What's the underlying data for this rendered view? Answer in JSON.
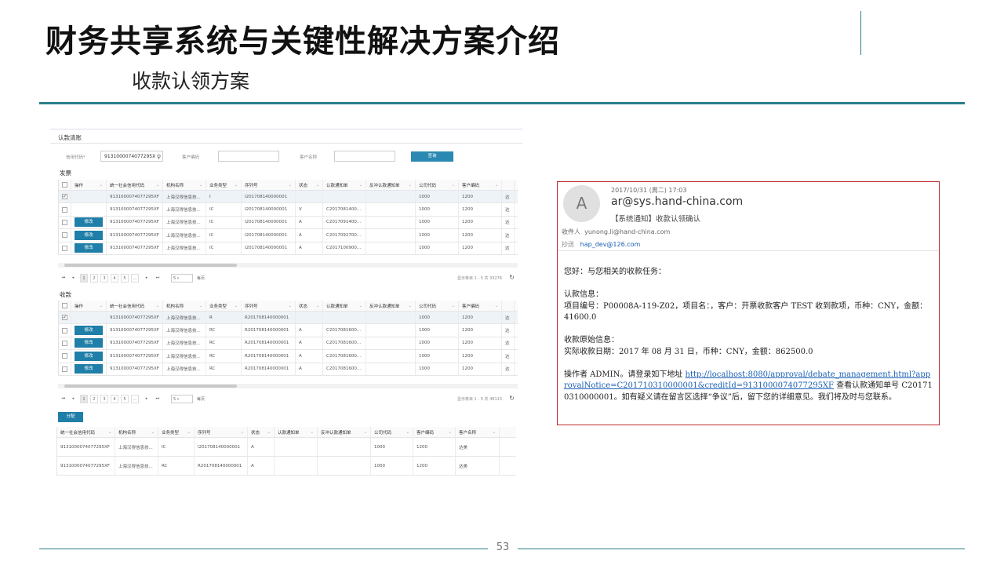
{
  "slide": {
    "title": "财务共享系统与关键性解决方案介绍",
    "subtitle": "收款认领方案",
    "page_number": "53"
  },
  "app": {
    "header": "认款清账",
    "filters": {
      "credit_code_label": "信用代码*",
      "credit_code_value": "9131000074077295X",
      "customer_code_label": "客户编码",
      "customer_name_label": "客户名称",
      "query_button": "查询"
    },
    "invoice_section": {
      "title": "发票",
      "columns": [
        "操作",
        "统一社会信用代码",
        "机构名称",
        "业务类型",
        "序列号",
        "状态",
        "认款通知单",
        "反冲认款通知单",
        "公司代码",
        "客户编码"
      ],
      "rows": [
        {
          "edit": "",
          "checked": "✓",
          "code": "9131000074077295XF",
          "org": "上海汉得信息技...",
          "type": "I",
          "serial": "I201708140000001",
          "status": "",
          "notice": "",
          "reverse": "",
          "company": "1000",
          "customer": "1200",
          "extra": "达"
        },
        {
          "edit": "",
          "checked": "",
          "code": "9131000074077295XF",
          "org": "上海汉得信息技...",
          "type": "IC",
          "serial": "I201708140000001",
          "status": "V",
          "notice": "C2017081400...",
          "reverse": "",
          "company": "1000",
          "customer": "1200",
          "extra": "达"
        },
        {
          "edit": "修改",
          "checked": "",
          "code": "9131000074077295XF",
          "org": "上海汉得信息技...",
          "type": "IC",
          "serial": "I201708140000001",
          "status": "A",
          "notice": "C2017091400...",
          "reverse": "",
          "company": "1000",
          "customer": "1200",
          "extra": "达"
        },
        {
          "edit": "修改",
          "checked": "",
          "code": "9131000074077295XF",
          "org": "上海汉得信息技...",
          "type": "IC",
          "serial": "I201708140000001",
          "status": "A",
          "notice": "C2017092700...",
          "reverse": "",
          "company": "1000",
          "customer": "1200",
          "extra": "达"
        },
        {
          "edit": "修改",
          "checked": "",
          "code": "9131000074077295XF",
          "org": "上海汉得信息技...",
          "type": "IC",
          "serial": "I201708140000001",
          "status": "A",
          "notice": "C2017100900...",
          "reverse": "",
          "company": "1000",
          "customer": "1200",
          "extra": "达"
        }
      ],
      "pager": {
        "pages": [
          "1",
          "2",
          "3",
          "4",
          "5",
          "..."
        ],
        "page_size": "5",
        "per_page_label": "每页",
        "info": "显示条目 1 - 5 共 33276"
      }
    },
    "receipt_section": {
      "title": "收款",
      "columns": [
        "操作",
        "统一社会信用代码",
        "机构名称",
        "业务类型",
        "序列号",
        "状态",
        "认款通知单",
        "反冲认款通知单",
        "公司代码",
        "客户编码"
      ],
      "rows": [
        {
          "edit": "",
          "checked": "✓",
          "code": "9131000074077295XF",
          "org": "上海汉得信息技...",
          "type": "R",
          "serial": "R201708140000001",
          "status": "",
          "notice": "",
          "reverse": "",
          "company": "1000",
          "customer": "1200",
          "extra": "达"
        },
        {
          "edit": "修改",
          "checked": "",
          "code": "9131000074077295XF",
          "org": "上海汉得信息技...",
          "type": "RC",
          "serial": "R201708140000001",
          "status": "A",
          "notice": "C2017081600...",
          "reverse": "",
          "company": "1000",
          "customer": "1200",
          "extra": "达"
        },
        {
          "edit": "修改",
          "checked": "",
          "code": "9131000074077295XF",
          "org": "上海汉得信息技...",
          "type": "RC",
          "serial": "R201708140000001",
          "status": "A",
          "notice": "C2017081600...",
          "reverse": "",
          "company": "1000",
          "customer": "1200",
          "extra": "达"
        },
        {
          "edit": "修改",
          "checked": "",
          "code": "9131000074077295XF",
          "org": "上海汉得信息技...",
          "type": "RC",
          "serial": "R201708140000001",
          "status": "A",
          "notice": "C2017081600...",
          "reverse": "",
          "company": "1000",
          "customer": "1200",
          "extra": "达"
        },
        {
          "edit": "修改",
          "checked": "",
          "code": "9131000074077295XF",
          "org": "上海汉得信息技...",
          "type": "RC",
          "serial": "R201708140000001",
          "status": "A",
          "notice": "C2017081600...",
          "reverse": "",
          "company": "1000",
          "customer": "1200",
          "extra": "达"
        }
      ],
      "pager": {
        "pages": [
          "1",
          "2",
          "3",
          "4",
          "5",
          "..."
        ],
        "page_size": "5",
        "per_page_label": "每页",
        "info": "显示条目 1 - 5 共 48113"
      }
    },
    "assign_button": "分配",
    "result_grid": {
      "columns": [
        "统一社会信用代码",
        "机构名称",
        "业务类型",
        "序列号",
        "状态",
        "认款通知单",
        "反冲认款通知单",
        "公司代码",
        "客户编码",
        "客户名称"
      ],
      "rows": [
        [
          "9131000074077295XF",
          "上海汉得信息技...",
          "IC",
          "I201708140000001",
          "A",
          "",
          "",
          "1000",
          "1200",
          "达美"
        ],
        [
          "9131000074077295XF",
          "上海汉得信息技...",
          "RC",
          "R201708140000001",
          "A",
          "",
          "",
          "1000",
          "1200",
          "达美"
        ]
      ]
    }
  },
  "email": {
    "avatar_letter": "A",
    "date": "2017/10/31 (周二) 17:03",
    "from": "ar@sys.hand-china.com",
    "subject": "【系统通知】收款认领确认",
    "to_label": "收件人",
    "to": "yunong.li@hand-china.com",
    "cc_label": "抄送",
    "cc": "hap_dev@126.com",
    "greeting": "您好：与您相关的收款任务：",
    "claim_title": "认款信息：",
    "claim_detail": "项目编号：P00008A-119-Z02，项目名：，客户：开票收款客户 TEST 收到款项，币种：CNY，金额：41600.0",
    "origin_title": "收款原始信息：",
    "origin_detail": "实际收款日期：2017 年 08 月 31 日，币种：CNY，金额：862500.0",
    "action_prefix": "操作者 ADMIN。请登录如下地址 ",
    "action_link": "http://localhost:8080/approval/debate_management.html?approvalNotice=C201710310000001&creditId=9131000074077295XF",
    "action_suffix": " 查看认款通知单号 C201710310000001。如有疑义请在留言区选择“争议”后，留下您的详细意见。我们将及时与您联系。"
  }
}
